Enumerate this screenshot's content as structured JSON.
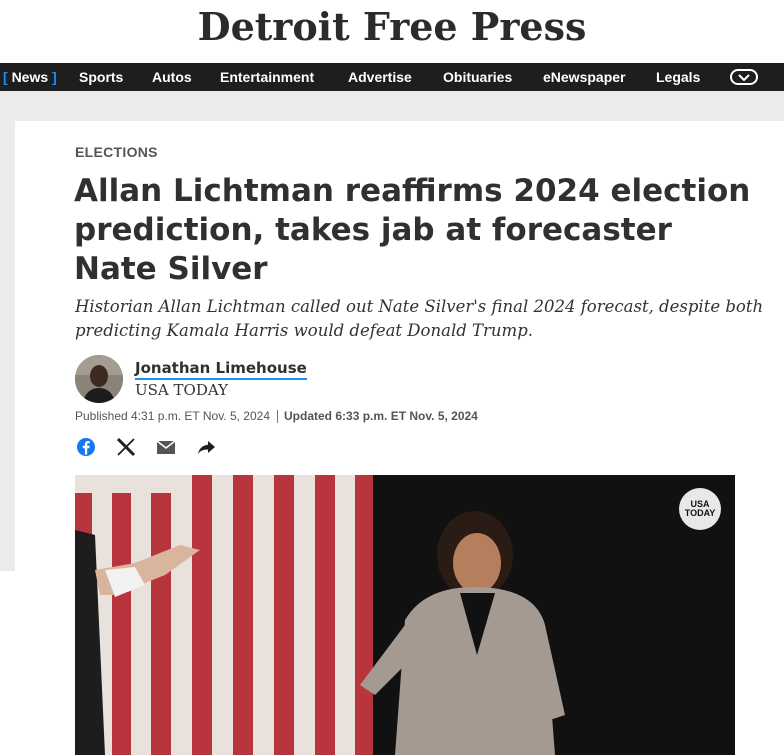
{
  "masthead": {
    "logo_text": "Detroit Free Press"
  },
  "nav": {
    "items": [
      "News",
      "Sports",
      "Autos",
      "Entertainment",
      "Advertise",
      "Obituaries",
      "eNewspaper",
      "Legals"
    ],
    "active_open_bracket": "[",
    "active_close_bracket": "]",
    "more_icon": "chevron-down-icon"
  },
  "article": {
    "section": "ELECTIONS",
    "headline": "Allan Lichtman reaffirms 2024 election prediction, takes jab at forecaster Nate Silver",
    "dek": "Historian Allan Lichtman called out Nate Silver's final 2024 forecast, despite both predicting Kamala Harris would defeat Donald Trump.",
    "author": "Jonathan Limehouse",
    "outlet": "USA TODAY",
    "published": "Published 4:31 p.m. ET Nov. 5, 2024",
    "updated": "Updated 6:33 p.m. ET Nov. 5, 2024"
  },
  "share": [
    "facebook-icon",
    "x-icon",
    "email-icon",
    "share-arrow-icon"
  ],
  "media": {
    "badge_line1": "USA",
    "badge_line2": "TODAY"
  },
  "colors": {
    "accent": "#1b8ef2",
    "nav_bg": "#1e1e1e",
    "page_bg": "#ebebeb",
    "facebook": "#1877f2"
  }
}
